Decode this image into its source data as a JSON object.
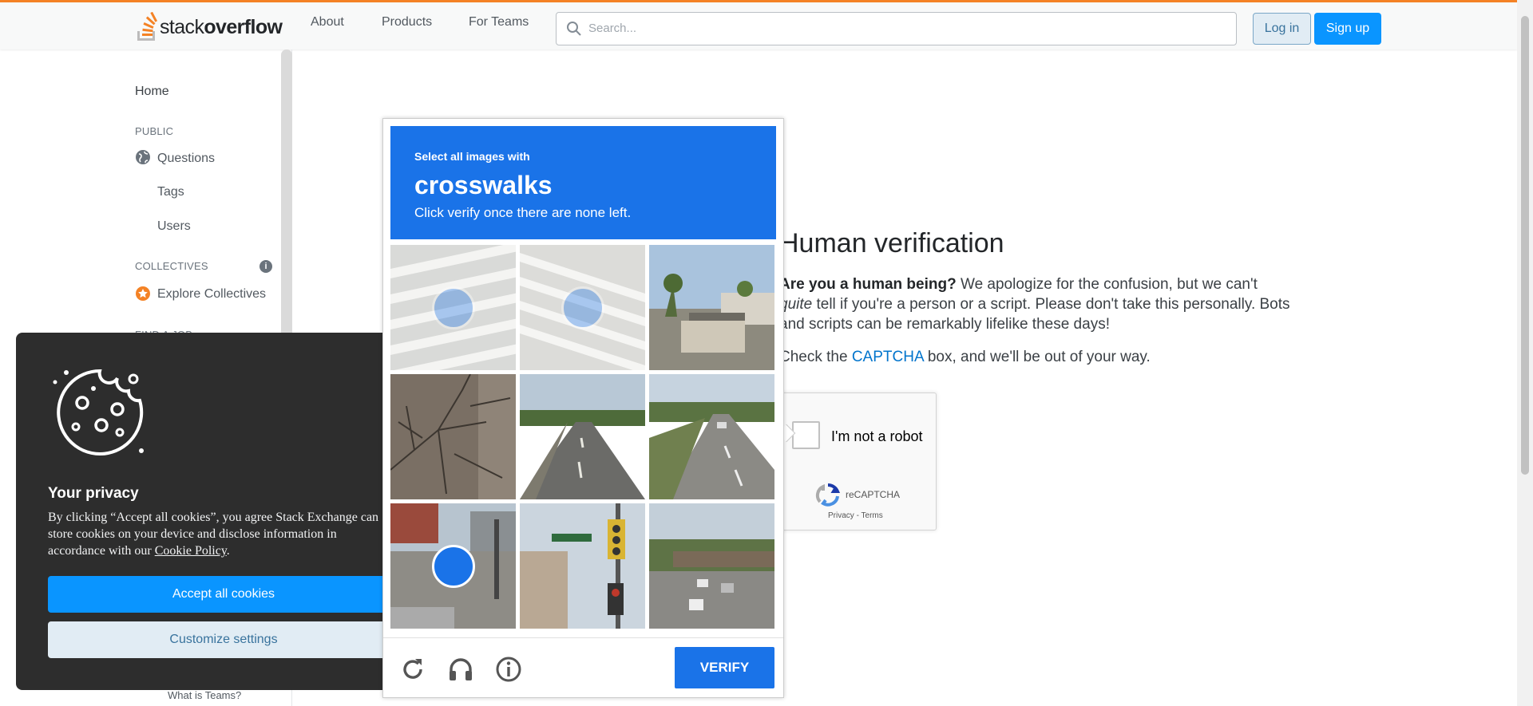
{
  "header": {
    "logo_text_light": "stack",
    "logo_text_bold": "overflow",
    "nav": [
      "About",
      "Products",
      "For Teams"
    ],
    "search_placeholder": "Search...",
    "login_label": "Log in",
    "signup_label": "Sign up",
    "accent_color": "#f48225"
  },
  "sidebar": {
    "home": "Home",
    "public_heading": "PUBLIC",
    "questions": "Questions",
    "tags": "Tags",
    "users": "Users",
    "collectives_heading": "COLLECTIVES",
    "explore_collectives": "Explore Collectives",
    "find_job_heading": "FIND A JOB",
    "what_is_teams": "What is Teams?"
  },
  "main": {
    "title": "Human verification",
    "p1_bold": "Are you a human being?",
    "p1_text_a": " We apologize for the confusion, but we can't ",
    "p1_em": "quite",
    "p1_text_b": " tell if you're a person or a script. Please don't take this personally. Bots and scripts can be remarkably lifelike these days!",
    "p2_before": "Check the ",
    "p2_link": "CAPTCHA",
    "p2_after": " box, and we'll be out of your way.",
    "recaptcha_label": "I'm not a robot",
    "recaptcha_brand": "reCAPTCHA",
    "recaptcha_privacy": "Privacy",
    "recaptcha_sep": " - ",
    "recaptcha_terms": "Terms"
  },
  "cookie": {
    "title": "Your privacy",
    "text_before": "By clicking “Accept all cookies”, you agree Stack Exchange can store cookies on your device and disclose information in accordance with our ",
    "policy_link": "Cookie Policy",
    "text_after": ".",
    "accept_label": "Accept all cookies",
    "customize_label": "Customize settings"
  },
  "captcha": {
    "instruction_small": "Select all images with",
    "target": "crosswalks",
    "instruction_sub": "Click verify once there are none left.",
    "verify_label": "VERIFY",
    "header_color": "#1a73e8",
    "tiles": [
      {
        "selected": true,
        "faded": true,
        "scene": "crosswalk stripes"
      },
      {
        "selected": true,
        "faded": true,
        "scene": "crosswalk stripes"
      },
      {
        "selected": false,
        "faded": false,
        "scene": "houses and palm trees"
      },
      {
        "selected": false,
        "faded": false,
        "scene": "bare tree branches"
      },
      {
        "selected": false,
        "faded": false,
        "scene": "empty road"
      },
      {
        "selected": false,
        "faded": false,
        "scene": "highway with car"
      },
      {
        "selected": true,
        "faded": false,
        "scene": "street corner"
      },
      {
        "selected": false,
        "faded": false,
        "scene": "traffic light and street sign"
      },
      {
        "selected": false,
        "faded": false,
        "scene": "highway overpass"
      }
    ],
    "footer_icons": [
      "reload-icon",
      "audio-icon",
      "info-icon"
    ]
  }
}
